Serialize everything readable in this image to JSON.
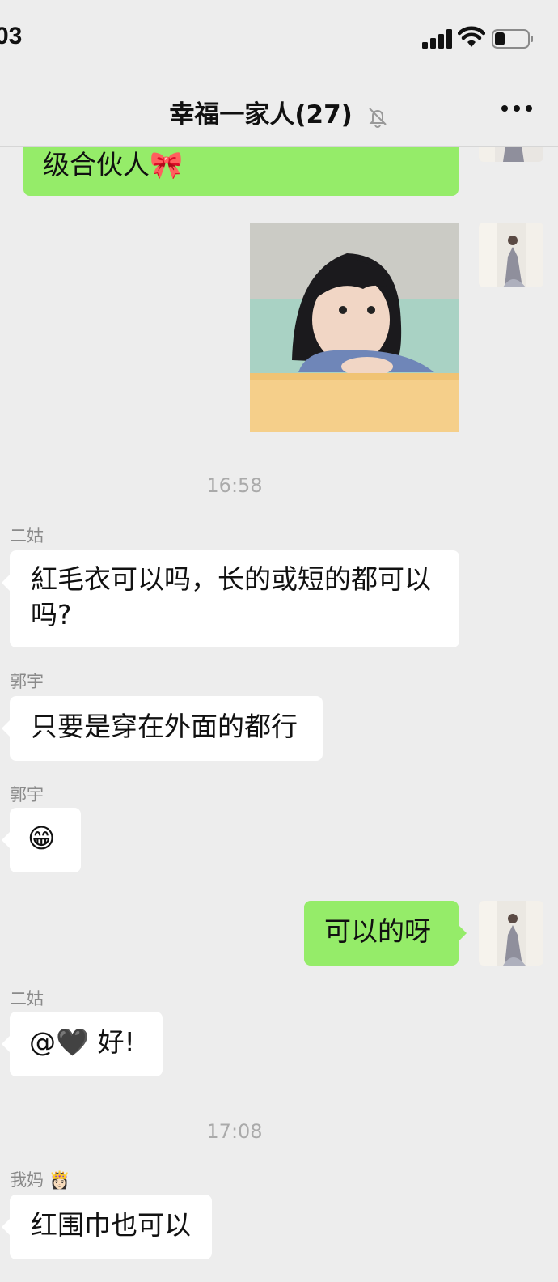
{
  "status_bar": {
    "time": "03"
  },
  "nav": {
    "title": "幸福一家人(27)"
  },
  "messages": {
    "m0": {
      "text": "级合伙人",
      "emoji": "🎀"
    },
    "t1": "16:58",
    "m2": {
      "sender": "二姑",
      "text": "紅毛衣可以吗，长的或短的都可以吗?"
    },
    "m3": {
      "sender": "郭宇",
      "text": "只要是穿在外面的都行"
    },
    "m4": {
      "sender": "郭宇",
      "emoji": "😁"
    },
    "m5": {
      "text": "可以的呀"
    },
    "m6": {
      "sender": "二姑",
      "text": "@🖤 好!"
    },
    "t2": "17:08",
    "m7": {
      "sender": "我妈",
      "sender_emoji": "👸🏻",
      "text": "红围巾也可以"
    }
  },
  "icons": [
    "signal-icon",
    "wifi-icon",
    "battery-icon",
    "mute-bell-icon",
    "more-icon"
  ],
  "colors": {
    "background": "#ededed",
    "self_bubble": "#95ec69",
    "other_bubble": "#ffffff",
    "meta_text": "#8a8a8a"
  }
}
